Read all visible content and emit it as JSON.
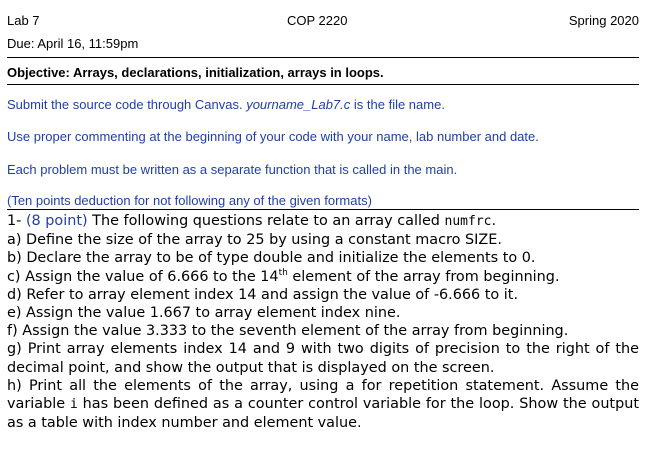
{
  "header": {
    "lab": "Lab 7",
    "course": "COP 2220",
    "term": "Spring 2020",
    "due": "Due: April 16, 11:59pm"
  },
  "objective": "Objective: Arrays, declarations, initialization, arrays in loops.",
  "instructions": {
    "submit_prefix": "Submit the source code through Canvas. ",
    "submit_filename": "yourname_Lab7.c",
    "submit_suffix": " is the file name.",
    "commenting": "Use proper commenting at the beginning of your code with your name, lab number and date.",
    "functions": "Each problem must be written as a separate function that is called in the main.",
    "deduction": "(Ten points deduction for not following any of the given formats)"
  },
  "problem": {
    "number": "1- ",
    "points": "(8 point)",
    "intro": " The following questions relate to an array called ",
    "array_name": "numfrc",
    "intro_end": ".",
    "a": "a) Define the size of the array to 25 by using a constant macro SIZE.",
    "b": "b) Declare the array to be of type double and initialize the elements to 0.",
    "c_pre": "c) Assign the value of 6.666 to the 14",
    "c_sup": "th",
    "c_post": " element of the array from beginning.",
    "d": "d) Refer to array element index 14 and assign the value of -6.666 to it.",
    "e": "e) Assign the value 1.667 to array element index nine.",
    "f": "f) Assign the value 3.333 to the seventh element of the array from beginning.",
    "g": "g) Print array elements index 14 and 9 with two digits of precision to the right of the decimal point, and show the output that is displayed on the screen.",
    "h_pre": "h) Print all the elements of the array, using a for repetition statement. Assume the variable ",
    "h_var": "i",
    "h_post": " has been defined as a counter control variable for the loop. Show the output as a table with index number and element value."
  }
}
